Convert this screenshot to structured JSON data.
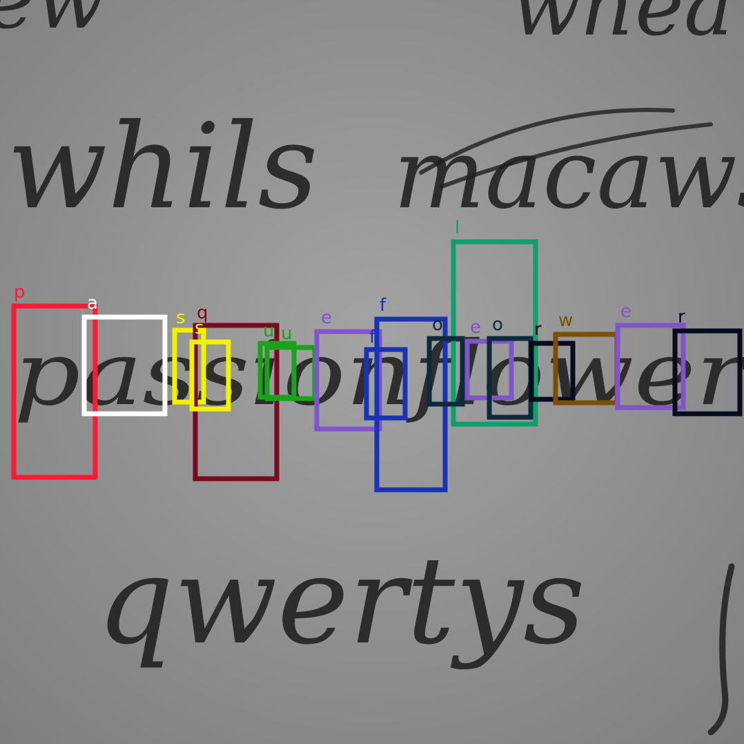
{
  "image": {
    "background_color": "#8f8f8f",
    "handwritten_words": [
      {
        "text": "whils"
      },
      {
        "text": "macaws"
      },
      {
        "text": "passionflower"
      },
      {
        "text": "qwertys"
      }
    ],
    "partial_words": [
      {
        "text": "ew"
      },
      {
        "text": "whea"
      }
    ]
  },
  "annotations": [
    {
      "label": "p",
      "color": "#ff1a33"
    },
    {
      "label": "a",
      "color": "#ffffff"
    },
    {
      "label": "s",
      "color": "#f2f200"
    },
    {
      "label": "q",
      "color": "#7a0a1e"
    },
    {
      "label": "s",
      "color": "#f2f200"
    },
    {
      "label": "u",
      "color": "#1aa31a"
    },
    {
      "label": "u",
      "color": "#1aa31a"
    },
    {
      "label": "e",
      "color": "#8055cc"
    },
    {
      "label": "f",
      "color": "#1a33b3"
    },
    {
      "label": "f",
      "color": "#1a33b3"
    },
    {
      "label": "l",
      "color": "#0f9e6e"
    },
    {
      "label": "o",
      "color": "#0d2a3a"
    },
    {
      "label": "e",
      "color": "#8055cc"
    },
    {
      "label": "o",
      "color": "#0d2a3a"
    },
    {
      "label": "r",
      "color": "#0a0a1e"
    },
    {
      "label": "w",
      "color": "#7a5000"
    },
    {
      "label": "e",
      "color": "#8055cc"
    },
    {
      "label": "r",
      "color": "#0a0a1e"
    }
  ]
}
